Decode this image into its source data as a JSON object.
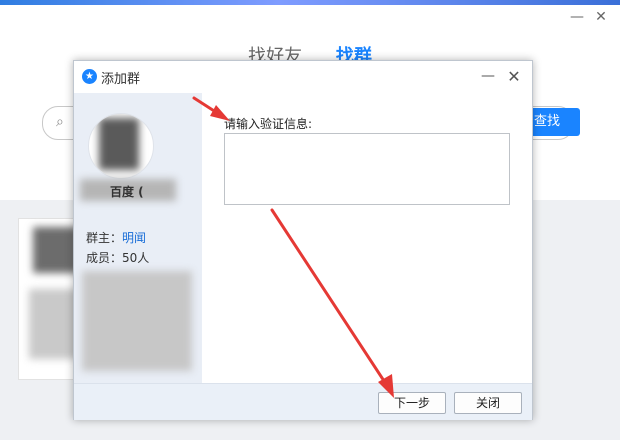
{
  "background_window": {
    "tabs": [
      {
        "label": "找好友",
        "active": false
      },
      {
        "label": "找群",
        "active": true
      }
    ],
    "search_button_label": "查找",
    "close_glyph": "✕",
    "minimize_glyph": "—"
  },
  "dialog": {
    "title": "添加群",
    "logo_glyph": "★",
    "minimize_glyph": "—",
    "close_glyph": "✕",
    "group_name": "百度 (",
    "owner_label": "群主：",
    "owner_name": "明闻",
    "members_label": "成员：",
    "members_count": "50人",
    "verification_label": "请输入验证信息:",
    "verification_value": "",
    "next_button_label": "下一步",
    "close_button_label": "关闭"
  },
  "colors": {
    "accent": "#1a84ff",
    "arrow": "#e53935",
    "footer_bg": "#eaf0f8",
    "panel_bg": "#e9eef6"
  }
}
